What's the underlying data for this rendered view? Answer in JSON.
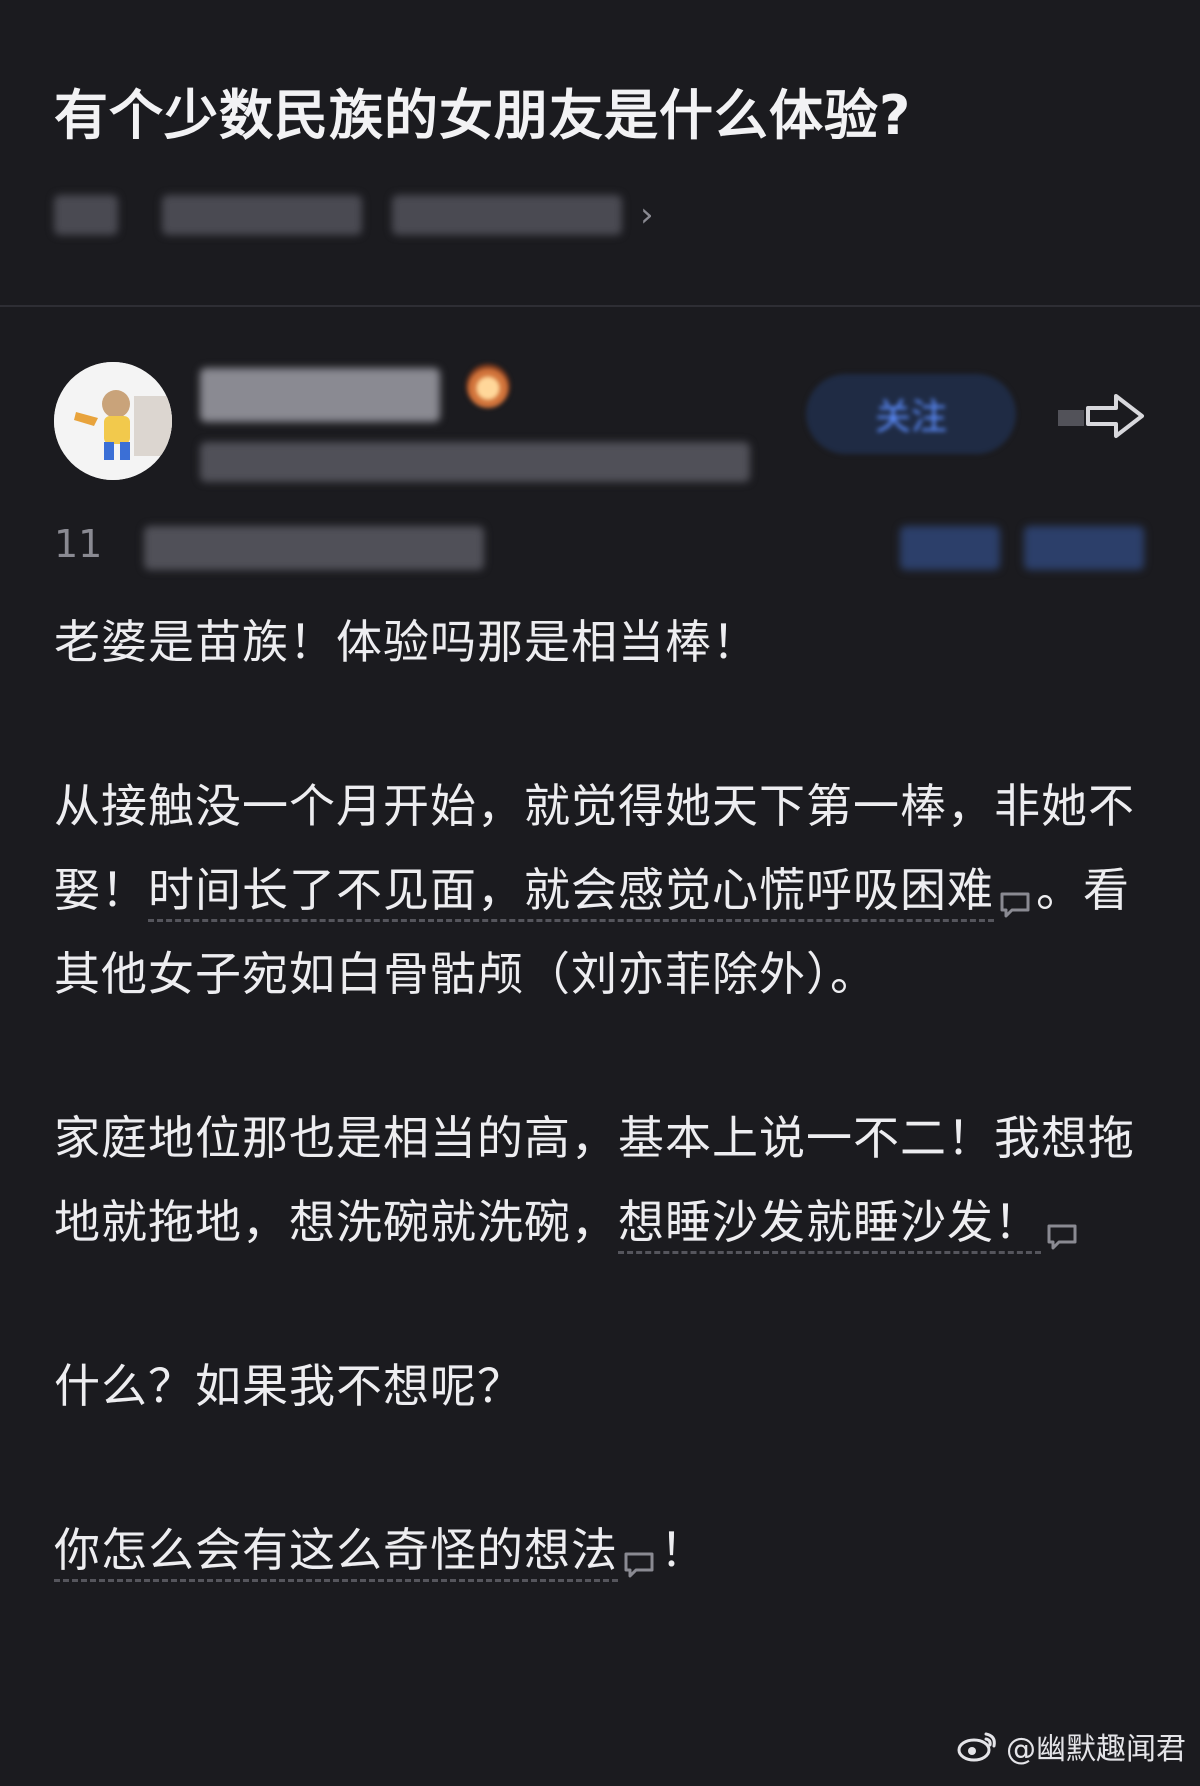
{
  "question": {
    "title": "有个少数民族的女朋友是什么体验?",
    "meta_more": "›"
  },
  "author": {
    "follow_label": "关注"
  },
  "stats": {
    "visible_prefix": "11"
  },
  "answer": {
    "p1": "老婆是苗族！体验吗那是相当棒！",
    "p2a": "从接触没一个月开始，就觉得她天下第一棒，非她不娶！",
    "p2b": "时间长了不见面，就会感觉心慌呼吸困难",
    "p2c": "。看其他女子宛如白骨骷颅（刘亦菲除外）。",
    "p3a": "家庭地位那也是相当的高，基本上说一不二！我想拖地就拖地，想洗碗就洗碗，",
    "p3b": "想睡沙发就睡沙发！",
    "p4": "什么？如果我不想呢？",
    "p5a": "你怎么会有这么奇怪的想法",
    "p5b": "！"
  },
  "watermark": {
    "text": "@幽默趣闻君"
  },
  "icons": {
    "comment": "comment-bubble-icon",
    "share": "share-arrow-icon",
    "chevron": "chevron-right-icon",
    "weibo": "weibo-logo-icon"
  },
  "colors": {
    "background": "#1b1b1f",
    "text": "#ededf0",
    "muted": "#8a8a92",
    "follow_bg": "#1f2b44",
    "follow_text": "#5b8dff"
  }
}
